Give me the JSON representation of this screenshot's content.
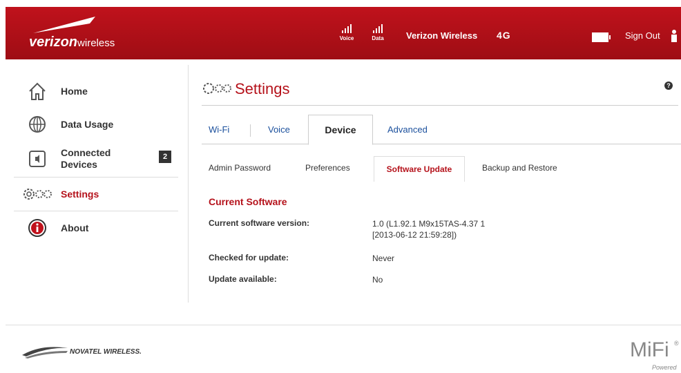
{
  "header": {
    "brand_main": "verizon",
    "brand_sub": "wireless",
    "voice_label": "Voice",
    "data_label": "Data",
    "carrier": "Verizon Wireless",
    "network": "4G",
    "signout_label": "Sign Out"
  },
  "sidebar": {
    "items": [
      {
        "label": "Home",
        "icon": "home-icon"
      },
      {
        "label": "Data Usage",
        "icon": "globe-icon"
      },
      {
        "label": "Connected\nDevices",
        "icon": "speaker-icon",
        "badge": "2"
      },
      {
        "label": "Settings",
        "icon": "gears-icon",
        "active": true
      },
      {
        "label": "About",
        "icon": "info-icon"
      }
    ]
  },
  "main": {
    "title": "Settings",
    "help": "?",
    "tabs": [
      "Wi-Fi",
      "Voice",
      "Device",
      "Advanced"
    ],
    "active_tab": "Device",
    "subtabs": [
      "Admin Password",
      "Preferences",
      "Software Update",
      "Backup and Restore"
    ],
    "active_subtab": "Software Update",
    "section_title": "Current Software",
    "fields": [
      {
        "label": "Current software version:",
        "value_line1": "1.0 (L1.92.1 M9x15TAS-4.37 1",
        "value_line2": "[2013-06-12 21:59:28])"
      },
      {
        "label": "Checked for update:",
        "value_line1": "Never"
      },
      {
        "label": "Update available:",
        "value_line1": "No"
      }
    ]
  },
  "footer": {
    "vendor": "NOVATEL WIRELESS.",
    "product": "MiFi",
    "product_mark": "®",
    "powered": "Powered"
  },
  "colors": {
    "header_red": "#b5121b",
    "accent_red": "#b5121b",
    "tab_link": "#1a4f9c"
  }
}
